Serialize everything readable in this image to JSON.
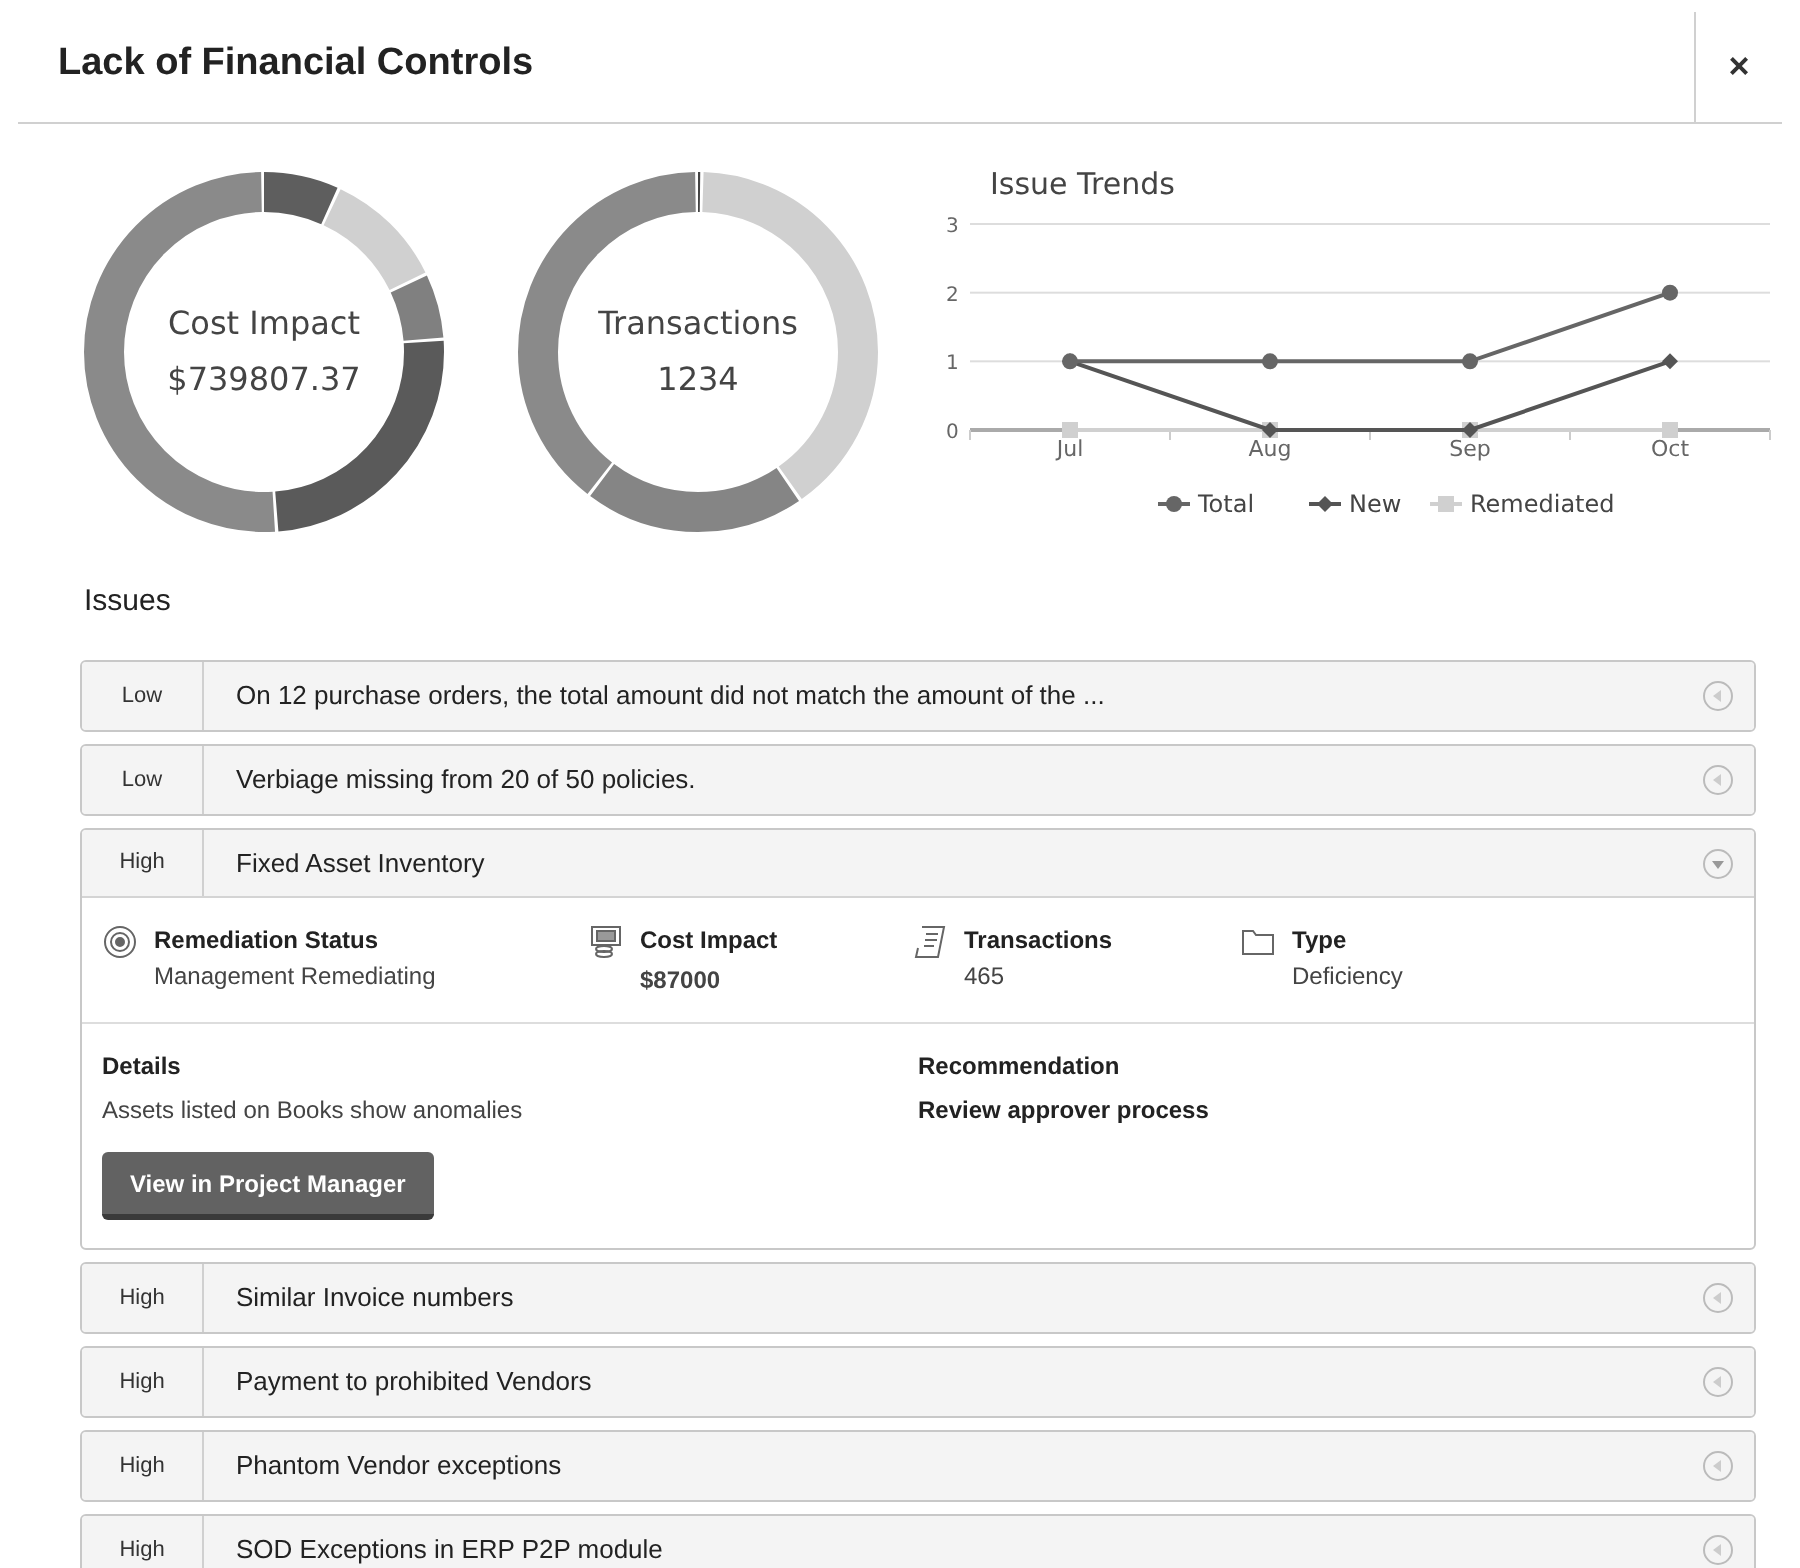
{
  "dialog": {
    "title": "Lack of Financial Controls",
    "close": "×"
  },
  "summary": [
    {
      "label": "Cost Impact",
      "value": "$739807.37"
    },
    {
      "label": "Transactions",
      "value": "1234"
    }
  ],
  "trend": {
    "chart_data": {
      "type": "line",
      "title": "Issue Trends",
      "categories": [
        "Jul",
        "Aug",
        "Sep",
        "Oct"
      ],
      "ylim": [
        0,
        3
      ],
      "yticks": [
        0,
        1,
        2,
        3
      ],
      "legend": "bottom",
      "series": [
        {
          "name": "Total",
          "color": "#666666",
          "marker": "circle",
          "values": [
            1,
            1,
            1,
            2
          ]
        },
        {
          "name": "New",
          "color": "#555555",
          "marker": "diamond",
          "values": [
            1,
            0,
            0,
            1
          ]
        },
        {
          "name": "Remediated",
          "color": "#d0d0d0",
          "marker": "square",
          "values": [
            0,
            0,
            0,
            0
          ]
        }
      ]
    }
  },
  "issues_heading": "Issues",
  "issues": [
    {
      "severity": "Low",
      "title": "On 12 purchase orders, the total amount did not match the amount of the ...",
      "expanded": false
    },
    {
      "severity": "Low",
      "title": "Verbiage missing from 20 of 50 policies.",
      "expanded": false
    },
    {
      "severity": "High",
      "title": "Fixed Asset Inventory",
      "expanded": true,
      "facts": [
        {
          "kind": "status",
          "label": "Remediation Status",
          "value": "Management Remediating"
        },
        {
          "kind": "cost",
          "label": "Cost Impact",
          "value": "$87000"
        },
        {
          "kind": "transactions",
          "label": "Transactions",
          "value": "465"
        },
        {
          "kind": "type",
          "label": "Type",
          "value": "Deficiency"
        }
      ],
      "details_label": "Details",
      "details": "Assets listed on Books show anomalies",
      "recommendation_label": "Recommendation",
      "recommendation": "Review approver process",
      "action": "View in Project Manager"
    },
    {
      "severity": "High",
      "title": "Similar Invoice numbers",
      "expanded": false
    },
    {
      "severity": "High",
      "title": "Payment to prohibited Vendors",
      "expanded": false
    },
    {
      "severity": "High",
      "title": "Phantom Vendor exceptions",
      "expanded": false
    },
    {
      "severity": "High",
      "title": "SOD Exceptions in ERP P2P module",
      "expanded": false
    }
  ]
}
